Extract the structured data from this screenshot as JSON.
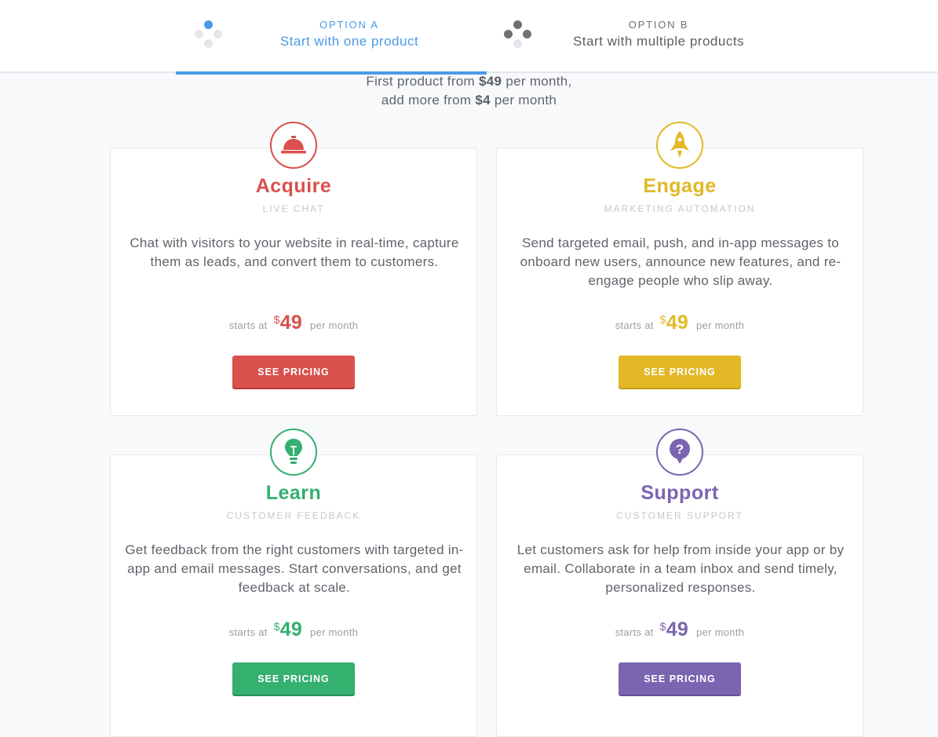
{
  "tabs": [
    {
      "label": "OPTION A",
      "title": "Start with one product",
      "active": true
    },
    {
      "label": "OPTION B",
      "title": "Start with multiple products",
      "active": false
    }
  ],
  "intro": {
    "line1_prefix": "First product from ",
    "line1_price": "$49",
    "line1_suffix": " per month,",
    "line2_prefix": "add more from ",
    "line2_price": "$4",
    "line2_suffix": " per month"
  },
  "colors": {
    "accent": "#4a9ae6",
    "acquire": "#d9504d",
    "engage": "#e2b826",
    "learn": "#34b06f",
    "support": "#7b65b1"
  },
  "products": [
    {
      "name": "Acquire",
      "subtitle": "LIVE CHAT",
      "icon": "service-bell-icon",
      "description": "Chat with visitors to your website in real-time, capture them as leads, and convert them to customers.",
      "price_prefix": "starts at",
      "currency": "$",
      "amount": "49",
      "price_suffix": "per month",
      "button": "SEE PRICING"
    },
    {
      "name": "Engage",
      "subtitle": "MARKETING AUTOMATION",
      "icon": "rocket-icon",
      "description": "Send targeted email, push, and in-app messages to onboard new users, announce new features, and re-engage people who slip away.",
      "price_prefix": "starts at",
      "currency": "$",
      "amount": "49",
      "price_suffix": "per month",
      "button": "SEE PRICING"
    },
    {
      "name": "Learn",
      "subtitle": "CUSTOMER FEEDBACK",
      "icon": "lightbulb-icon",
      "description": "Get feedback from the right customers with targeted in-app and email messages. Start conversations, and get feedback at scale.",
      "price_prefix": "starts at",
      "currency": "$",
      "amount": "49",
      "price_suffix": "per month",
      "button": "SEE PRICING"
    },
    {
      "name": "Support",
      "subtitle": "CUSTOMER SUPPORT",
      "icon": "question-bubble-icon",
      "description": "Let customers ask for help from inside your app or by email. Collaborate in a team inbox and send timely, personalized responses.",
      "price_prefix": "starts at",
      "currency": "$",
      "amount": "49",
      "price_suffix": "per month",
      "button": "SEE PRICING"
    }
  ]
}
